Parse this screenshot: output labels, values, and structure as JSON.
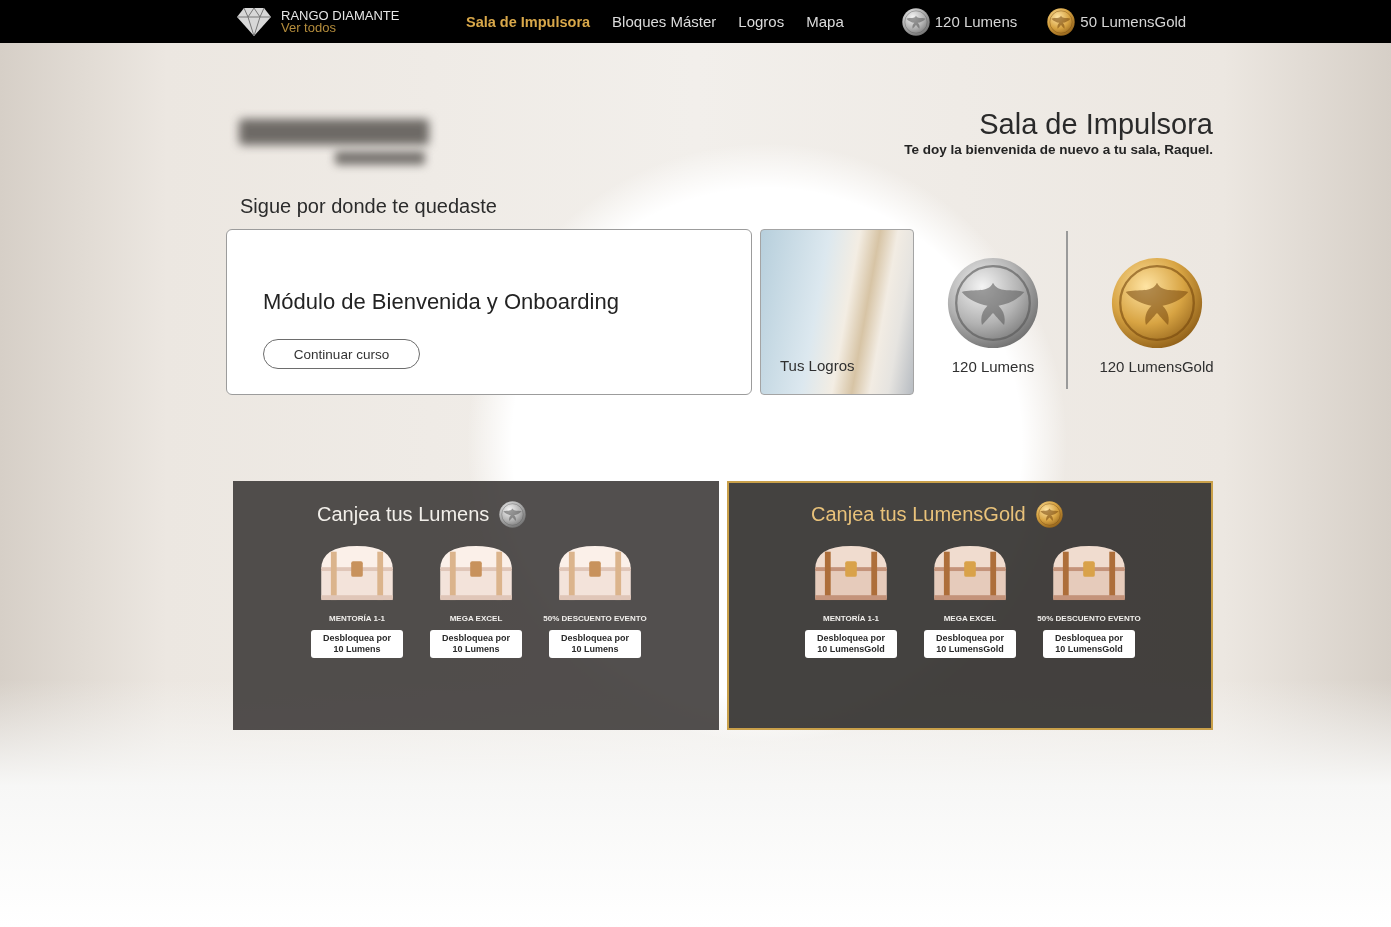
{
  "top_bar": {
    "rank": {
      "title": "RANGO DIAMANTE",
      "link": "Ver todos"
    },
    "nav": [
      {
        "label": "Sala de Impulsora",
        "selected": true
      },
      {
        "label": "Bloques Máster",
        "selected": false
      },
      {
        "label": "Logros",
        "selected": false
      },
      {
        "label": "Mapa",
        "selected": false
      }
    ],
    "balances": [
      {
        "kind": "silver",
        "label": "120 Lumens"
      },
      {
        "kind": "gold",
        "label": "50 LumensGold"
      }
    ]
  },
  "header": {
    "title": "Sala de Impulsora",
    "subtitle": "Te doy la bienvenida de nuevo a tu sala, Raquel."
  },
  "continue": {
    "heading": "Sigue por donde te quedaste",
    "course_title": "Módulo de Bienvenida y Onboarding",
    "button": "Continuar curso"
  },
  "achievements_card": {
    "label": "Tus Logros"
  },
  "medals": [
    {
      "kind": "silver",
      "label": "120 Lumens"
    },
    {
      "kind": "gold",
      "label": "120 LumensGold"
    }
  ],
  "redeem_panels": [
    {
      "kind": "silver",
      "title": "Canjea tus Lumens",
      "rewards": [
        {
          "name": "MENTORÍA 1-1",
          "button": "Desbloquea por 10 Lumens"
        },
        {
          "name": "MEGA EXCEL",
          "button": "Desbloquea por 10 Lumens"
        },
        {
          "name": "50% DESCUENTO EVENTO",
          "button": "Desbloquea por 10 Lumens"
        }
      ]
    },
    {
      "kind": "gold",
      "title": "Canjea tus LumensGold",
      "rewards": [
        {
          "name": "MENTORÍA 1-1",
          "button": "Desbloquea por 10 LumensGold"
        },
        {
          "name": "MEGA EXCEL",
          "button": "Desbloquea por 10 LumensGold"
        },
        {
          "name": "50% DESCUENTO EVENTO",
          "button": "Desbloquea por 10 LumensGold"
        }
      ]
    }
  ]
}
